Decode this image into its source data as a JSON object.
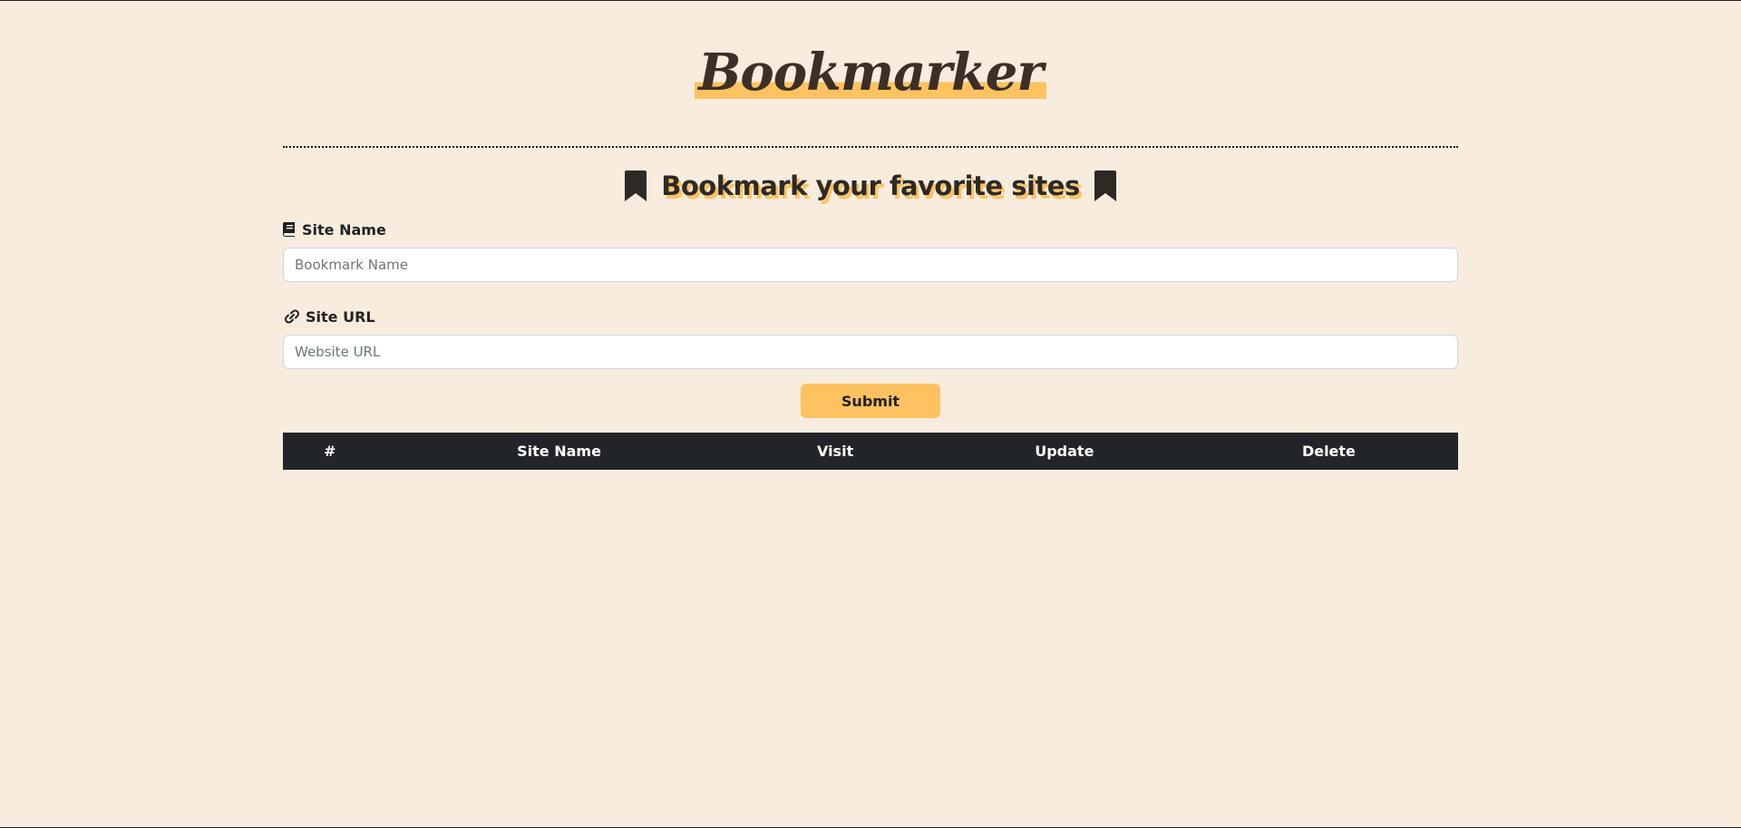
{
  "header": {
    "brand": "Bookmarker"
  },
  "section": {
    "title": "Bookmark your favorite sites"
  },
  "form": {
    "site_name": {
      "label": "Site Name",
      "placeholder": "Bookmark Name",
      "value": ""
    },
    "site_url": {
      "label": "Site URL",
      "placeholder": "Website URL",
      "value": ""
    },
    "submit_label": "Submit"
  },
  "table": {
    "columns": [
      "#",
      "Site Name",
      "Visit",
      "Update",
      "Delete"
    ],
    "rows": []
  },
  "colors": {
    "background": "#f8ecdf",
    "accent": "#fec260",
    "dark": "#212529"
  },
  "icons": {
    "title_left": "bookmark-icon",
    "title_right": "bookmark-icon",
    "site_name": "book-icon",
    "site_url": "link-icon"
  }
}
